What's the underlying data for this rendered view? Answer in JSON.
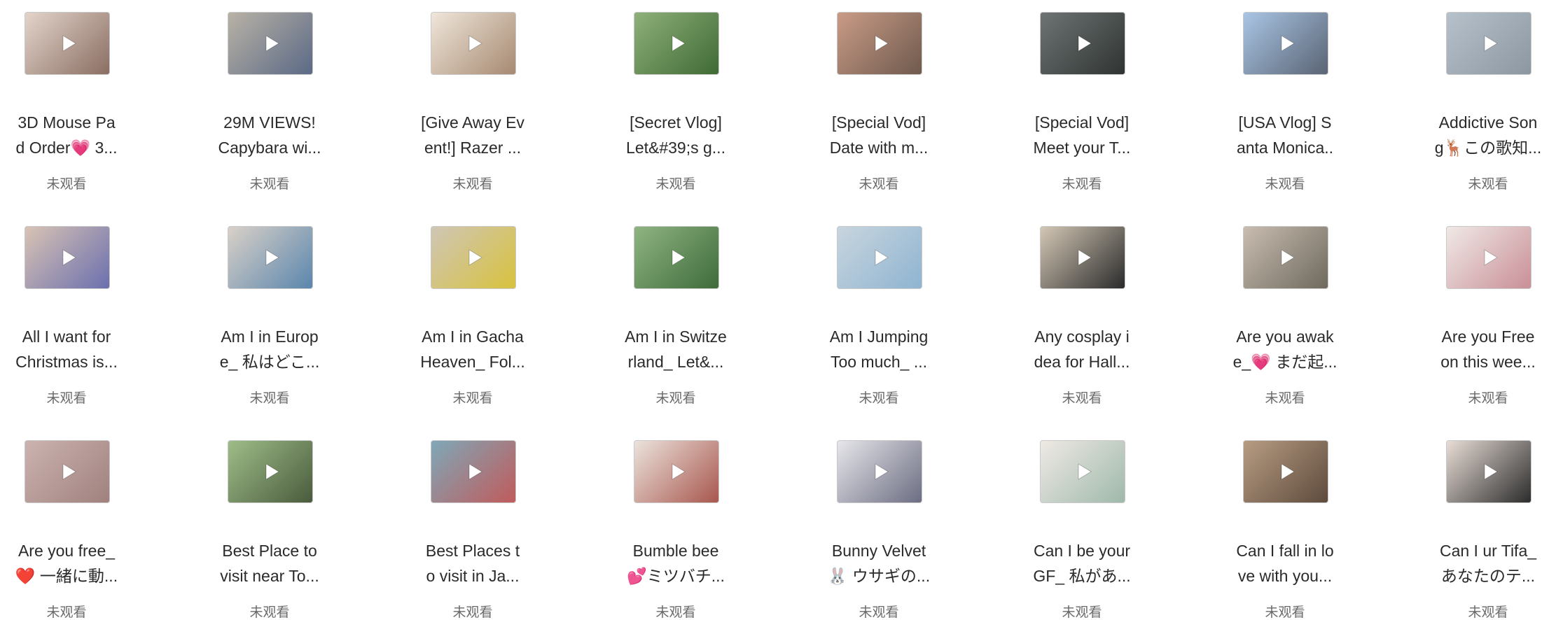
{
  "status_label": "未观看",
  "colors": {
    "title_text": "#2a2a2a",
    "status_text": "#6a6a6a",
    "thumbnail_border": "#c9c9c9",
    "play_icon": "#ffffff"
  },
  "items": [
    {
      "line1": "3D Mouse Pa",
      "line2": "d Order💗 3...",
      "status": "未观看",
      "thumb": [
        "#e3d4ca",
        "#8a6e63"
      ],
      "icon": "play-icon"
    },
    {
      "line1": "29M VIEWS!",
      "line2": "Capybara wi...",
      "status": "未观看",
      "thumb": [
        "#b9b2a6",
        "#5b6a86"
      ],
      "icon": "play-icon"
    },
    {
      "line1": "[Give Away Ev",
      "line2": "ent!] Razer ...",
      "status": "未观看",
      "thumb": [
        "#efe6da",
        "#a78a72"
      ],
      "icon": "play-icon"
    },
    {
      "line1": "[Secret Vlog]",
      "line2": "Let&#39;s g...",
      "status": "未观看",
      "thumb": [
        "#8fb07a",
        "#3f6a34"
      ],
      "icon": "play-icon"
    },
    {
      "line1": "[Special Vod]",
      "line2": "Date with m...",
      "status": "未观看",
      "thumb": [
        "#c99b86",
        "#6f5a4e"
      ],
      "icon": "play-icon"
    },
    {
      "line1": "[Special Vod]",
      "line2": "Meet your T...",
      "status": "未观看",
      "thumb": [
        "#6e7473",
        "#2f3433"
      ],
      "icon": "play-icon"
    },
    {
      "line1": "[USA Vlog] S",
      "line2": "anta Monica..",
      "status": "未观看",
      "thumb": [
        "#a9c5e4",
        "#5a6474"
      ],
      "icon": "play-icon"
    },
    {
      "line1": "Addictive Son",
      "line2": "g🦌この歌知...",
      "status": "未观看",
      "thumb": [
        "#b7c1ca",
        "#8d97a2"
      ],
      "icon": "play-icon"
    },
    {
      "line1": "All I want for",
      "line2": "Christmas is...",
      "status": "未观看",
      "thumb": [
        "#d8c3b4",
        "#6b6fae"
      ],
      "icon": "play-icon"
    },
    {
      "line1": "Am I in Europ",
      "line2": "e_ 私はどこ...",
      "status": "未观看",
      "thumb": [
        "#d9d1c8",
        "#5b86ad"
      ],
      "icon": "play-icon"
    },
    {
      "line1": "Am I in Gacha",
      "line2": "Heaven_ Fol...",
      "status": "未观看",
      "thumb": [
        "#cfc6b6",
        "#d8c23e"
      ],
      "icon": "play-icon"
    },
    {
      "line1": "Am I in Switze",
      "line2": "rland_ Let&...",
      "status": "未观看",
      "thumb": [
        "#8fb482",
        "#3e6b3a"
      ],
      "icon": "play-icon"
    },
    {
      "line1": "Am I Jumping",
      "line2": "Too much_ ...",
      "status": "未观看",
      "thumb": [
        "#c8d5de",
        "#8fb4d1"
      ],
      "icon": "play-icon"
    },
    {
      "line1": "Any cosplay i",
      "line2": "dea for Hall...",
      "status": "未观看",
      "thumb": [
        "#d3c7b5",
        "#2b2b2b"
      ],
      "icon": "play-icon"
    },
    {
      "line1": "Are you awak",
      "line2": "e_💗 まだ起...",
      "status": "未观看",
      "thumb": [
        "#c9bcb1",
        "#6e6a5d"
      ],
      "icon": "play-icon"
    },
    {
      "line1": "Are you Free",
      "line2": "on this wee...",
      "status": "未观看",
      "thumb": [
        "#efe9e6",
        "#c98f97"
      ],
      "icon": "play-icon"
    },
    {
      "line1": "Are you free_",
      "line2": "❤️ 一緒に動...",
      "status": "未观看",
      "thumb": [
        "#cbb3b0",
        "#a0817e"
      ],
      "icon": "play-icon"
    },
    {
      "line1": "Best Place to",
      "line2": "visit near To...",
      "status": "未观看",
      "thumb": [
        "#9ebd88",
        "#4a5b3d"
      ],
      "icon": "play-icon"
    },
    {
      "line1": "Best Places t",
      "line2": "o visit in Ja...",
      "status": "未观看",
      "thumb": [
        "#7fa8b8",
        "#c05b5b"
      ],
      "icon": "play-icon"
    },
    {
      "line1": "Bumble bee",
      "line2": "💕ミツバチ...",
      "status": "未观看",
      "thumb": [
        "#ebe3dc",
        "#a8574e"
      ],
      "icon": "play-icon"
    },
    {
      "line1": "Bunny Velvet",
      "line2": "🐰 ウサギの...",
      "status": "未观看",
      "thumb": [
        "#e6e6ea",
        "#6c6d82"
      ],
      "icon": "play-icon"
    },
    {
      "line1": "Can I be your",
      "line2": "GF_ 私があ...",
      "status": "未观看",
      "thumb": [
        "#efe9e4",
        "#9fb9ab"
      ],
      "icon": "play-icon"
    },
    {
      "line1": "Can I fall in lo",
      "line2": "ve with you...",
      "status": "未观看",
      "thumb": [
        "#b79c82",
        "#5e4b3d"
      ],
      "icon": "play-icon"
    },
    {
      "line1": "Can I ur Tifa_",
      "line2": "あなたのテ...",
      "status": "未观看",
      "thumb": [
        "#e8ddd6",
        "#2c2c2c"
      ],
      "icon": "play-icon"
    }
  ]
}
